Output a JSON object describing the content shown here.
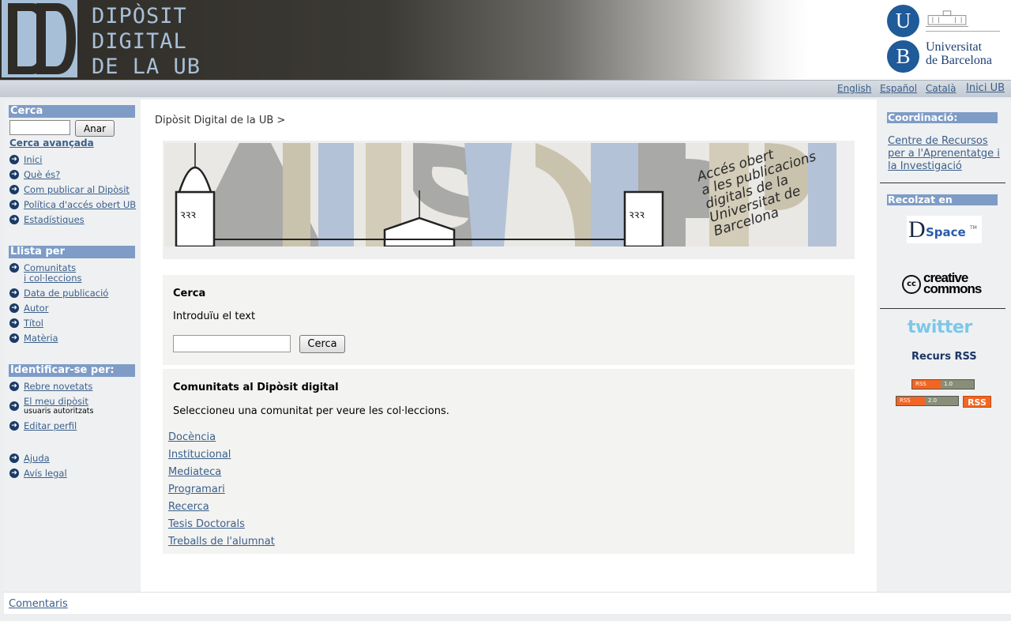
{
  "header": {
    "site_title_lines": [
      "DIPÒSIT",
      "DIGITAL",
      "DE LA UB"
    ],
    "university_initials": [
      "U",
      "B"
    ],
    "university_name_lines": [
      "Universitat",
      "de Barcelona"
    ]
  },
  "languages": [
    {
      "label": "English"
    },
    {
      "label": "Español"
    },
    {
      "label": "Català"
    },
    {
      "label": "Inici UB"
    }
  ],
  "left_sidebar": {
    "search_heading": "Cerca",
    "search_input_value": "",
    "search_button": "Anar",
    "advanced_search": "Cerca avançada",
    "nav_items": [
      "Inici",
      "Què és?",
      "Com publicar al Dipòsit",
      "Política d'accés obert UB",
      "Estadístiques"
    ],
    "list_heading": "Llista per",
    "list_items": [
      "Comunitats",
      "i  col·leccions",
      "Data de publicació",
      "Autor",
      "Títol",
      "Matèria"
    ],
    "identify_heading": "Identificar-se per:",
    "identify_items": [
      "Rebre novetats",
      "El meu dipòsit",
      "usuaris autoritzats",
      "Editar perfil"
    ],
    "help_items": [
      "Ajuda",
      "Avís legal"
    ]
  },
  "main": {
    "breadcrumb": "Dipòsit Digital de la UB >",
    "banner_text": [
      "Accés obert",
      "a les publicacions",
      "digitals de la",
      "Universitat de",
      "Barcelona"
    ],
    "search_panel": {
      "title": "Cerca",
      "prompt": "Introduïu el text",
      "input_value": "",
      "button": "Cerca"
    },
    "communities_panel": {
      "title": "Comunitats al Dipòsit digital",
      "prompt": "Seleccioneu una comunitat per veure les col·leccions.",
      "communities": [
        "Docència",
        "Institucional",
        "Mediateca",
        "Programari",
        "Recerca",
        "Tesis Doctorals",
        "Treballs de l'alumnat"
      ]
    }
  },
  "right_sidebar": {
    "coordination_heading": "Coordinació:",
    "coordination_link": "Centre de Recursos per a l'Aprenentatge i la Investigació",
    "supported_heading": "Recolzat en",
    "dspace_logo_text": [
      "D",
      "Space",
      "TM"
    ],
    "cc_logo_text": [
      "creative",
      "commons",
      "cc"
    ],
    "twitter_text": "twitter",
    "rss_title": "Recurs RSS",
    "rss_badges": [
      {
        "left": "RSS",
        "right": "1.0"
      },
      {
        "left": "RSS",
        "right": "2.0"
      }
    ],
    "rss_big": "RSS"
  },
  "footer": {
    "comments": "Comentaris"
  },
  "colors": {
    "accent_header": "#7e9cc6",
    "link": "#3b5f8a",
    "ub_blue": "#1f5a99",
    "rss_orange": "#f26522"
  }
}
